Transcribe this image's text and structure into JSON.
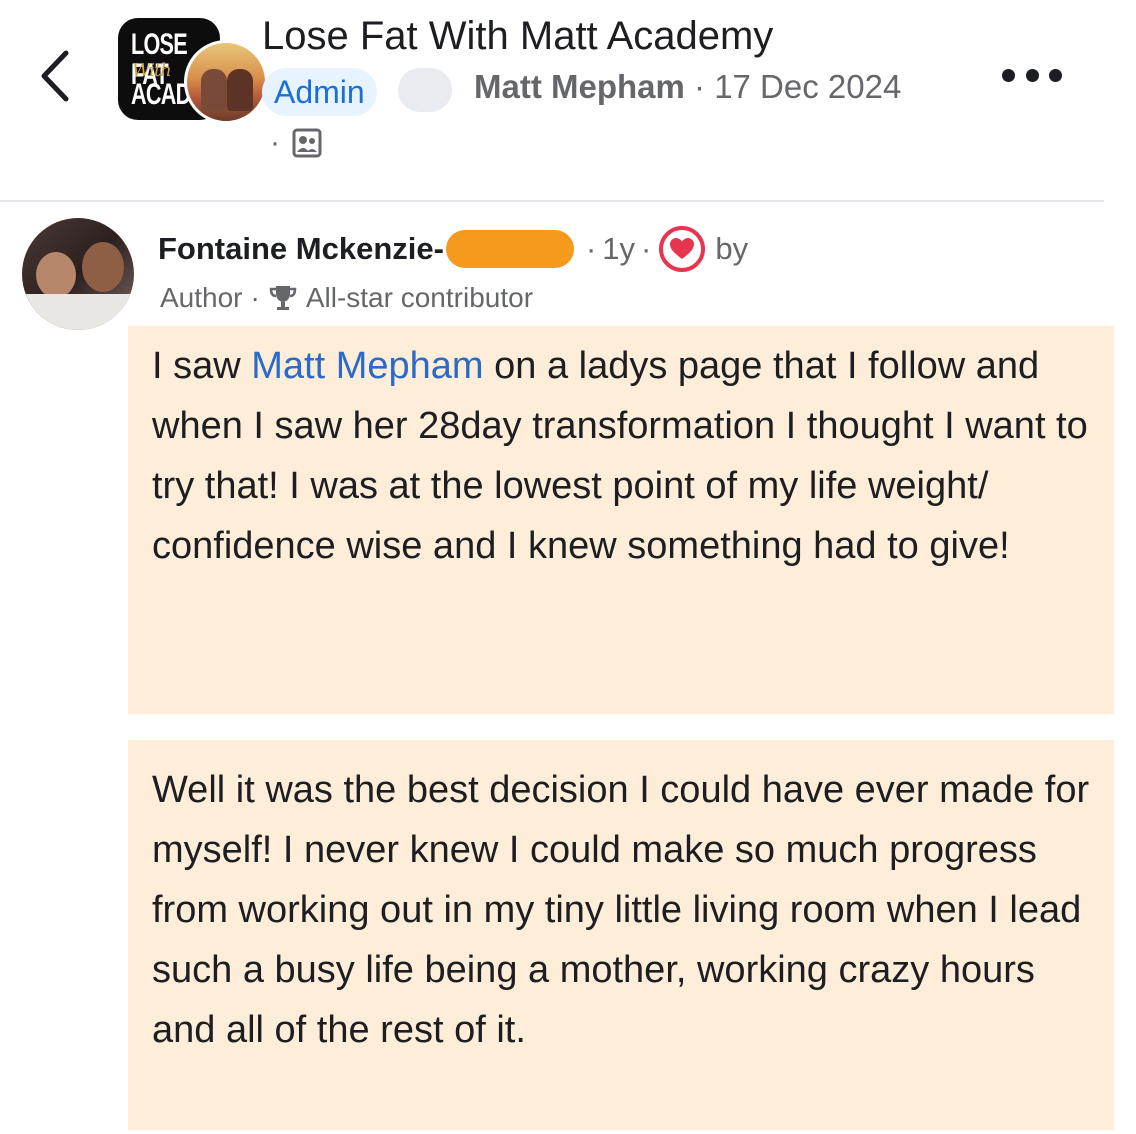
{
  "header": {
    "group_name": "Lose Fat With Matt Academy",
    "group_logo_lines": [
      "LOSE FAT",
      "With",
      "ACAD"
    ],
    "admin_badge": "Admin",
    "author_name": "Matt Mepham",
    "separator": "·",
    "post_date": "17 Dec 2024",
    "audience_dot": "·"
  },
  "comment": {
    "author_name": "Fontaine Mckenzie-",
    "time": "1y",
    "separator": "·",
    "by_label": "by",
    "role": "Author",
    "badge": "All-star contributor",
    "paragraph1": {
      "before": "I saw ",
      "mention": "Matt Mepham",
      "after": " on a ladys page that I follow and when I saw her 28day transformation I thought I want to try that! I was at the lowest point of my life weight/ confidence wise and I knew something had to give!"
    },
    "paragraph2": "Well it was the best decision I could have ever made for myself! I never knew I could make so much progress from working out in my tiny little living room when I lead such a busy life being a mother, working crazy hours and all of the rest of it."
  },
  "colors": {
    "highlight_bg": "#feedd8",
    "mention": "#2a6bc9",
    "admin_badge_bg": "#e7f3ff",
    "admin_badge_text": "#1b6fd8",
    "heart": "#e8344e",
    "redaction": "#f59a1c"
  },
  "icons": [
    "back-chevron-icon",
    "more-options-icon",
    "audience-group-icon",
    "heart-reaction-icon",
    "trophy-icon"
  ]
}
